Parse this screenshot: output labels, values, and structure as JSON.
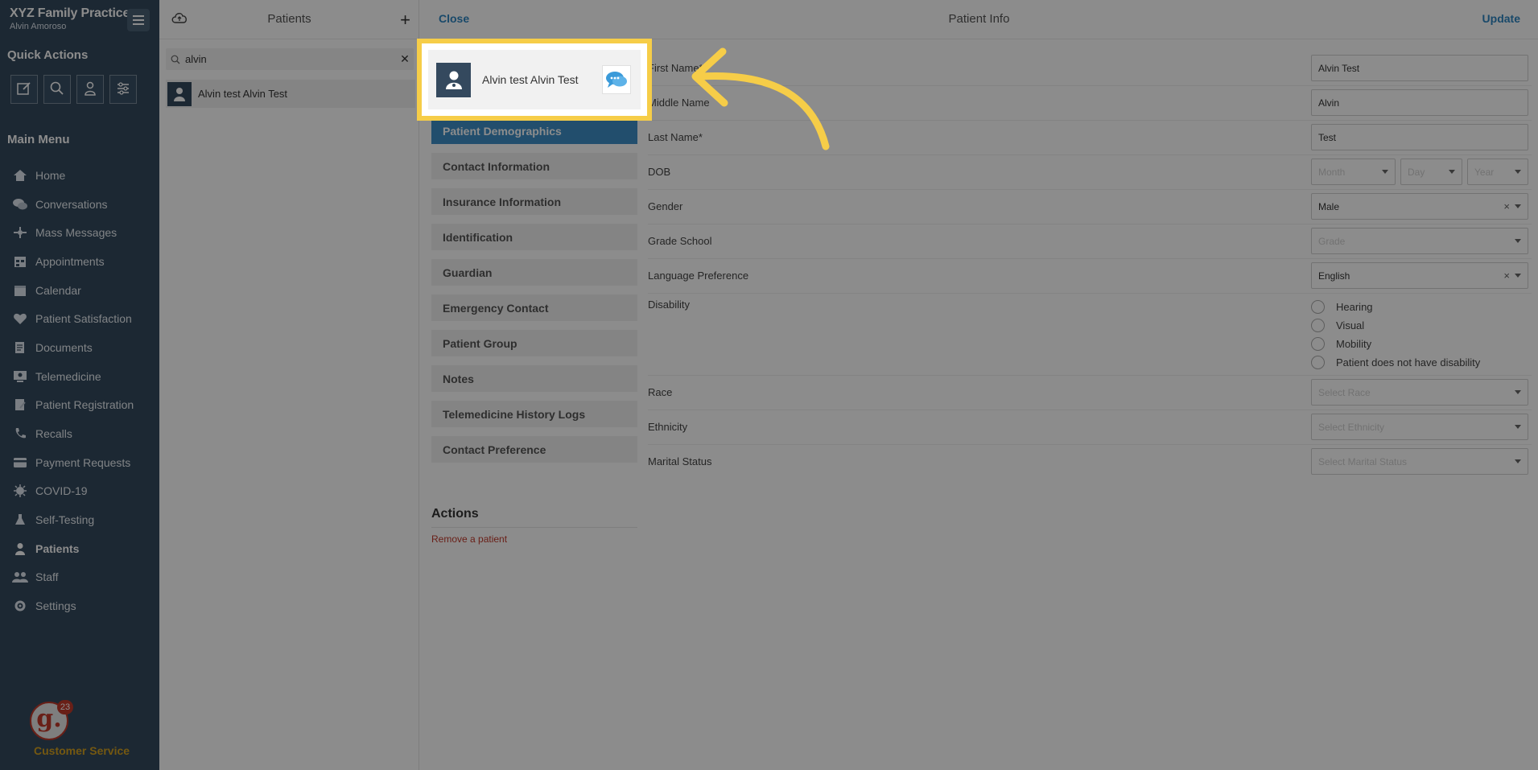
{
  "sidebar": {
    "practice_name": "XYZ Family Practice",
    "user_name": "Alvin Amoroso",
    "quick_actions_title": "Quick Actions",
    "main_menu_title": "Main Menu",
    "items": [
      {
        "label": "Home",
        "icon": "home-icon"
      },
      {
        "label": "Conversations",
        "icon": "chat-icon"
      },
      {
        "label": "Mass Messages",
        "icon": "broadcast-icon"
      },
      {
        "label": "Appointments",
        "icon": "appointment-icon"
      },
      {
        "label": "Calendar",
        "icon": "calendar-icon"
      },
      {
        "label": "Patient Satisfaction",
        "icon": "heart-icon"
      },
      {
        "label": "Documents",
        "icon": "document-icon"
      },
      {
        "label": "Telemedicine",
        "icon": "telemedicine-icon"
      },
      {
        "label": "Patient Registration",
        "icon": "registration-icon"
      },
      {
        "label": "Recalls",
        "icon": "phone-icon"
      },
      {
        "label": "Payment Requests",
        "icon": "card-icon"
      },
      {
        "label": "COVID-19",
        "icon": "virus-icon"
      },
      {
        "label": "Self-Testing",
        "icon": "flask-icon"
      },
      {
        "label": "Patients",
        "icon": "patient-icon"
      },
      {
        "label": "Staff",
        "icon": "staff-icon"
      },
      {
        "label": "Settings",
        "icon": "gear-icon"
      }
    ],
    "active_item": "Patients",
    "customer_service": {
      "label": "Customer Service",
      "badge": "23",
      "logo_letter": "g."
    }
  },
  "patients_panel": {
    "title": "Patients",
    "search_value": "alvin",
    "results": [
      {
        "name": "Alvin test Alvin Test"
      }
    ]
  },
  "patient_info": {
    "close_label": "Close",
    "title": "Patient Info",
    "update_label": "Update",
    "popup_name": "Alvin test Alvin Test",
    "tabs": [
      {
        "label": "Patient Demographics",
        "active": true
      },
      {
        "label": "Contact Information"
      },
      {
        "label": "Insurance Information"
      },
      {
        "label": "Identification"
      },
      {
        "label": "Guardian"
      },
      {
        "label": "Emergency Contact"
      },
      {
        "label": "Patient Group"
      },
      {
        "label": "Notes"
      },
      {
        "label": "Telemedicine History Logs"
      },
      {
        "label": "Contact Preference"
      }
    ],
    "actions_title": "Actions",
    "remove_label": "Remove a patient",
    "fields": {
      "first_name": {
        "label": "First Name*",
        "value": "Alvin Test"
      },
      "middle_name": {
        "label": "Middle Name",
        "value": "Alvin"
      },
      "last_name": {
        "label": "Last Name*",
        "value": "Test"
      },
      "dob": {
        "label": "DOB",
        "month_ph": "Month",
        "day_ph": "Day",
        "year_ph": "Year"
      },
      "gender": {
        "label": "Gender",
        "value": "Male"
      },
      "grade_school": {
        "label": "Grade School",
        "placeholder": "Grade"
      },
      "language": {
        "label": "Language Preference",
        "value": "English"
      },
      "disability": {
        "label": "Disability",
        "options": [
          "Hearing",
          "Visual",
          "Mobility",
          "Patient does not have disability"
        ]
      },
      "race": {
        "label": "Race",
        "placeholder": "Select Race"
      },
      "ethnicity": {
        "label": "Ethnicity",
        "placeholder": "Select Ethnicity"
      },
      "marital": {
        "label": "Marital Status",
        "placeholder": "Select Marital Status"
      }
    }
  },
  "colors": {
    "sidebar_bg": "#34495e",
    "accent_blue": "#3f8fc7",
    "highlight_yellow": "#f6cd48",
    "danger_red": "#c0392b"
  }
}
